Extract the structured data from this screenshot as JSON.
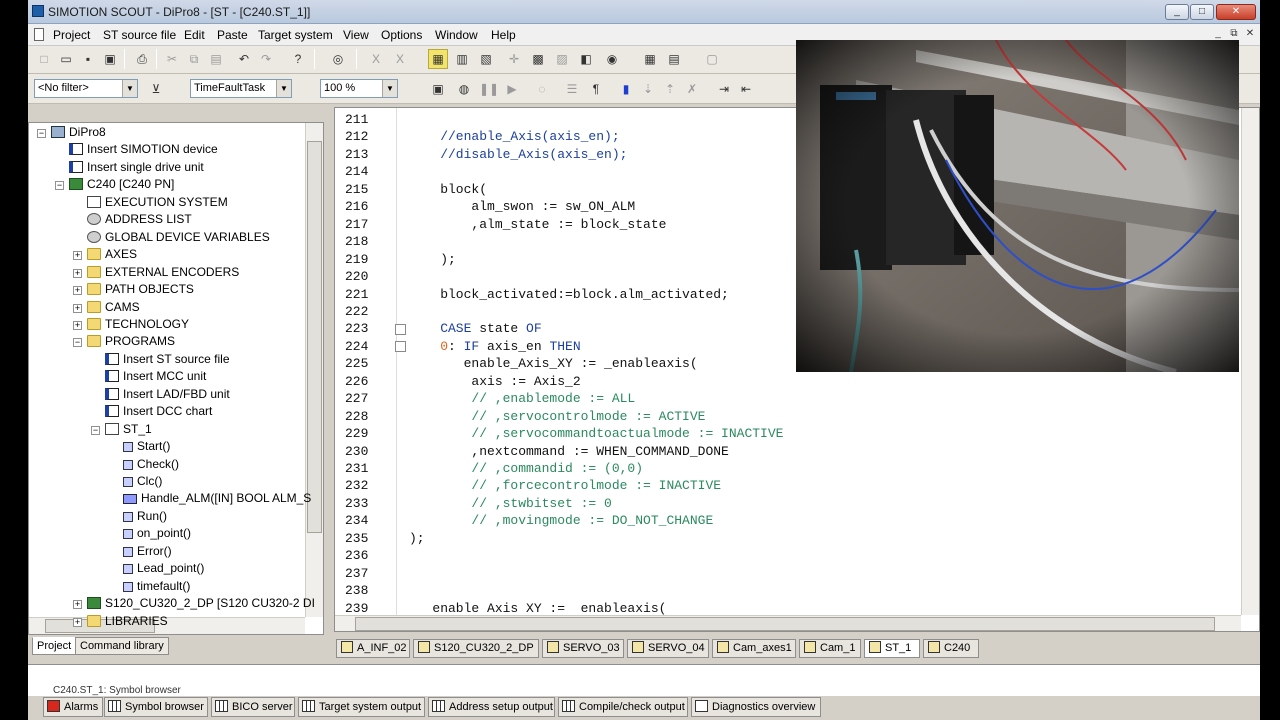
{
  "window": {
    "title": "SIMOTION SCOUT - DiPro8 - [ST - [C240.ST_1]]",
    "buttons": [
      "_",
      "□",
      "✕"
    ]
  },
  "menu": {
    "items": [
      "Project",
      "ST source file",
      "Edit",
      "Paste",
      "Target system",
      "View",
      "Options",
      "Window",
      "Help"
    ],
    "mdi_buttons": [
      "_",
      "⧉",
      "✕"
    ]
  },
  "toolbar": {
    "filter_value": "<No filter>",
    "task_value": "TimeFaultTask",
    "zoom_value": "100 %"
  },
  "tree": {
    "nodes": [
      {
        "label": "DiPro8",
        "icon": "project-root-icon",
        "expander": "−"
      },
      {
        "label": "Insert SIMOTION device",
        "icon": "insert-device-icon"
      },
      {
        "label": "Insert single drive unit",
        "icon": "insert-drive-icon"
      },
      {
        "label": "C240 [C240 PN]",
        "icon": "controller-icon",
        "expander": "−"
      },
      {
        "label": "EXECUTION SYSTEM",
        "icon": "execution-system-icon"
      },
      {
        "label": "ADDRESS LIST",
        "icon": "address-list-icon"
      },
      {
        "label": "GLOBAL DEVICE VARIABLES",
        "icon": "global-variables-icon"
      },
      {
        "label": "AXES",
        "icon": "folder-icon",
        "expander": "+"
      },
      {
        "label": "EXTERNAL ENCODERS",
        "icon": "folder-icon",
        "expander": "+"
      },
      {
        "label": "PATH OBJECTS",
        "icon": "folder-icon",
        "expander": "+"
      },
      {
        "label": "CAMS",
        "icon": "folder-icon",
        "expander": "+"
      },
      {
        "label": "TECHNOLOGY",
        "icon": "folder-icon",
        "expander": "+"
      },
      {
        "label": "PROGRAMS",
        "icon": "folder-icon",
        "expander": "−"
      },
      {
        "label": "Insert ST source file",
        "icon": "insert-st-icon"
      },
      {
        "label": "Insert MCC unit",
        "icon": "insert-mcc-icon"
      },
      {
        "label": "Insert LAD/FBD unit",
        "icon": "insert-lad-icon"
      },
      {
        "label": "Insert DCC chart",
        "icon": "insert-dcc-icon"
      },
      {
        "label": "ST_1",
        "icon": "st-source-icon",
        "expander": "−"
      },
      {
        "label": "Start()",
        "icon": "program-icon"
      },
      {
        "label": "Check()",
        "icon": "program-icon"
      },
      {
        "label": "Clc()",
        "icon": "program-icon"
      },
      {
        "label": "Handle_ALM([IN] BOOL ALM_S",
        "icon": "function-block-icon"
      },
      {
        "label": "Run()",
        "icon": "program-icon"
      },
      {
        "label": "on_point()",
        "icon": "program-icon"
      },
      {
        "label": "Error()",
        "icon": "program-icon"
      },
      {
        "label": "Lead_point()",
        "icon": "program-icon"
      },
      {
        "label": "timefault()",
        "icon": "program-icon"
      },
      {
        "label": "S120_CU320_2_DP [S120 CU320-2 DI",
        "icon": "drive-unit-icon",
        "expander": "+"
      },
      {
        "label": "LIBRARIES",
        "icon": "folder-icon",
        "expander": "+"
      }
    ],
    "tabs": [
      "Project",
      "Command library"
    ]
  },
  "editor": {
    "lines": [
      {
        "num": "211",
        "segments": []
      },
      {
        "num": "212",
        "segments": [
          {
            "t": "    //enable_Axis(axis_en);",
            "c": "c-blue"
          }
        ]
      },
      {
        "num": "213",
        "segments": [
          {
            "t": "    //disable_Axis(axis_en);",
            "c": "c-blue"
          }
        ]
      },
      {
        "num": "214",
        "segments": []
      },
      {
        "num": "215",
        "segments": [
          {
            "t": "    block(",
            "c": "c-black"
          }
        ]
      },
      {
        "num": "216",
        "segments": [
          {
            "t": "        alm_swon := sw_ON_ALM",
            "c": "c-black"
          }
        ]
      },
      {
        "num": "217",
        "segments": [
          {
            "t": "        ,alm_state := block_state",
            "c": "c-black"
          }
        ]
      },
      {
        "num": "218",
        "segments": []
      },
      {
        "num": "219",
        "segments": [
          {
            "t": "    );",
            "c": "c-black"
          }
        ]
      },
      {
        "num": "220",
        "segments": []
      },
      {
        "num": "221",
        "segments": [
          {
            "t": "    block_activated:=block.alm_activated;",
            "c": "c-black"
          }
        ]
      },
      {
        "num": "222",
        "segments": []
      },
      {
        "num": "223",
        "segments": [
          {
            "t": "    CASE",
            "c": "c-blue"
          },
          {
            "t": " state ",
            "c": "c-black"
          },
          {
            "t": "OF",
            "c": "c-blue"
          }
        ]
      },
      {
        "num": "224",
        "segments": [
          {
            "t": "    0",
            "c": "c-orange"
          },
          {
            "t": ": ",
            "c": "c-black"
          },
          {
            "t": "IF",
            "c": "c-blue"
          },
          {
            "t": " axis_en ",
            "c": "c-black"
          },
          {
            "t": "THEN",
            "c": "c-blue"
          }
        ]
      },
      {
        "num": "225",
        "segments": [
          {
            "t": "       enable_Axis_XY := _enableaxis(",
            "c": "c-black"
          }
        ]
      },
      {
        "num": "226",
        "segments": [
          {
            "t": "        axis := Axis_2",
            "c": "c-black"
          }
        ]
      },
      {
        "num": "227",
        "segments": [
          {
            "t": "        // ,enablemode := ALL",
            "c": "c-green"
          }
        ]
      },
      {
        "num": "228",
        "segments": [
          {
            "t": "        // ,servocontrolmode := ACTIVE",
            "c": "c-green"
          }
        ]
      },
      {
        "num": "229",
        "segments": [
          {
            "t": "        // ,servocommandtoactualmode := INACTIVE",
            "c": "c-green"
          }
        ]
      },
      {
        "num": "230",
        "segments": [
          {
            "t": "        ,nextcommand := WHEN_COMMAND_DONE",
            "c": "c-black"
          }
        ]
      },
      {
        "num": "231",
        "segments": [
          {
            "t": "        // ,commandid := (0,0)",
            "c": "c-green"
          }
        ]
      },
      {
        "num": "232",
        "segments": [
          {
            "t": "        // ,forcecontrolmode := INACTIVE",
            "c": "c-green"
          }
        ]
      },
      {
        "num": "233",
        "segments": [
          {
            "t": "        // ,stwbitset := 0",
            "c": "c-green"
          }
        ]
      },
      {
        "num": "234",
        "segments": [
          {
            "t": "        // ,movingmode := DO_NOT_CHANGE",
            "c": "c-green"
          }
        ]
      },
      {
        "num": "235",
        "segments": [
          {
            "t": ");",
            "c": "c-black"
          }
        ]
      },
      {
        "num": "236",
        "segments": []
      },
      {
        "num": "237",
        "segments": []
      },
      {
        "num": "238",
        "segments": []
      },
      {
        "num": "239",
        "segments": [
          {
            "t": "   enable Axis XY :=  enableaxis(",
            "c": "c-black"
          }
        ]
      }
    ]
  },
  "doc_tabs": [
    "A_INF_02",
    "S120_CU320_2_DP",
    "SERVO_03",
    "SERVO_04",
    "Cam_axes1",
    "Cam_1",
    "ST_1",
    "C240"
  ],
  "detail": {
    "title": "C240.ST_1: Symbol browser"
  },
  "bottom_tabs": [
    "Alarms",
    "Symbol browser",
    "BICO server",
    "Target system output",
    "Address setup output",
    "Compile/check output",
    "Diagnostics overview"
  ]
}
